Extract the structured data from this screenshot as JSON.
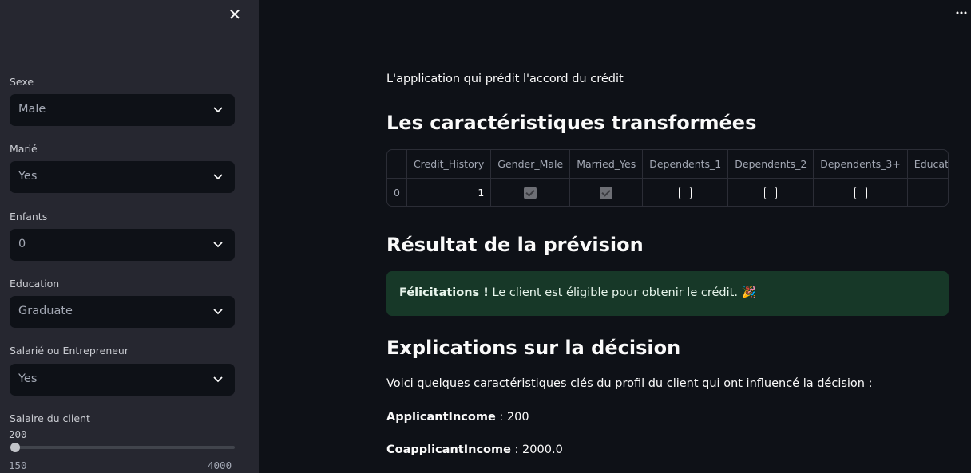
{
  "sidebar": {
    "fields": [
      {
        "label": "Sexe",
        "value": "Male"
      },
      {
        "label": "Marié",
        "value": "Yes"
      },
      {
        "label": "Enfants",
        "value": "0"
      },
      {
        "label": "Education",
        "value": "Graduate"
      },
      {
        "label": "Salarié ou Entrepreneur",
        "value": "Yes"
      }
    ],
    "salary": {
      "label": "Salaire du client",
      "value": "200",
      "min": "150",
      "max": "4000",
      "level": 0.013
    }
  },
  "main": {
    "subtitle": "L'application qui prédit l'accord du crédit",
    "section1_title": "Les caractéristiques transformées",
    "table": {
      "columns": [
        "",
        "Credit_History",
        "Gender_Male",
        "Married_Yes",
        "Dependents_1",
        "Dependents_2",
        "Dependents_3+",
        "Educatio"
      ],
      "row": {
        "index": "0",
        "credit_history": "1",
        "gender_male": true,
        "married_yes": true,
        "dependents_1": false,
        "dependents_2": false,
        "dependents_3plus": false
      }
    },
    "section2_title": "Résultat de la prévision",
    "alert": {
      "bold": "Félicitations !",
      "text": " Le client est éligible pour obtenir le crédit. 🎉"
    },
    "section3_title": "Explications sur la décision",
    "explanation_intro": "Voici quelques caractéristiques clés du profil du client qui ont influencé la décision :",
    "features": [
      {
        "name": "ApplicantIncome",
        "value": " : 200"
      },
      {
        "name": "CoapplicantIncome",
        "value": " : 2000.0"
      }
    ]
  },
  "colors": {
    "background": "#0e1117",
    "sidebar": "#262730",
    "success": "#173828"
  }
}
